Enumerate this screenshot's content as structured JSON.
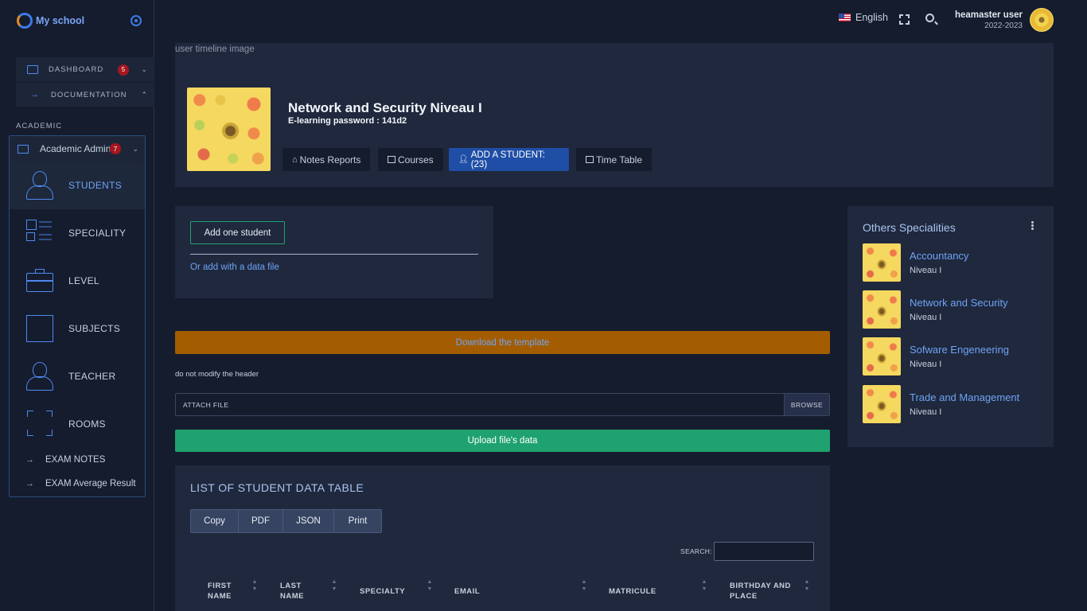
{
  "app": {
    "name": "My school"
  },
  "topbar": {
    "language": "English",
    "user_name": "heamaster user",
    "user_year": "2022-2023"
  },
  "sidebar": {
    "nav": [
      {
        "label": "DASHBOARD",
        "badge": "5"
      },
      {
        "label": "DOCUMENTATION"
      }
    ],
    "section_label": "ACADEMIC",
    "academic": {
      "label": "Academic Admin",
      "badge": "7",
      "items": [
        {
          "label": "STUDENTS",
          "icon": "person-icon"
        },
        {
          "label": "SPECIALITY",
          "icon": "grid-list-icon"
        },
        {
          "label": "LEVEL",
          "icon": "briefcase-icon"
        },
        {
          "label": "SUBJECTS",
          "icon": "square-icon"
        },
        {
          "label": "TEACHER",
          "icon": "person-icon"
        },
        {
          "label": "ROOMS",
          "icon": "frame-corners-icon"
        }
      ],
      "links": [
        {
          "label": "EXAM NOTES"
        },
        {
          "label": "EXAM Average Result"
        }
      ]
    }
  },
  "header": {
    "image_alt": "user timeline image",
    "title": "Network and Security Niveau I",
    "password": "E-learning password : 141d2",
    "buttons": {
      "notes": "Notes Reports",
      "courses": "Courses",
      "add_student": "ADD A STUDENT: (23)",
      "timetable": "Time Table"
    }
  },
  "add_card": {
    "add_one": "Add one student",
    "add_file": "Or add with a data file"
  },
  "upload_section": {
    "download_template": "Download the template",
    "hint": "do not modify the header",
    "attach_placeholder": "ATTACH FILE",
    "browse": "BROWSE",
    "upload": "Upload file's data"
  },
  "table": {
    "title": "LIST OF STUDENT DATA TABLE",
    "export": [
      "Copy",
      "PDF",
      "JSON",
      "Print"
    ],
    "search_label": "SEARCH:",
    "columns": [
      {
        "line1": "FIRST",
        "line2": "NAME"
      },
      {
        "line1": "LAST",
        "line2": "NAME"
      },
      {
        "line1": "SPECIALTY",
        "line2": ""
      },
      {
        "line1": "EMAIL",
        "line2": ""
      },
      {
        "line1": "MATRICULE",
        "line2": ""
      },
      {
        "line1": "BIRTHDAY AND",
        "line2": "PLACE"
      }
    ]
  },
  "others": {
    "title": "Others Specialities",
    "items": [
      {
        "name": "Accountancy",
        "level": "Niveau I"
      },
      {
        "name": "Network and Security",
        "level": "Niveau I"
      },
      {
        "name": "Sofware Engeneering",
        "level": "Niveau I"
      },
      {
        "name": "Trade and Management",
        "level": "Niveau I"
      }
    ]
  },
  "colors": {
    "background": "#151c2e",
    "card": "#1f283d",
    "accent_blue": "#1f4ea6",
    "link_blue": "#6fa3f4",
    "success_green": "#1fa26f",
    "warning_orange": "#a35d00",
    "badge_red": "#a5161f"
  }
}
